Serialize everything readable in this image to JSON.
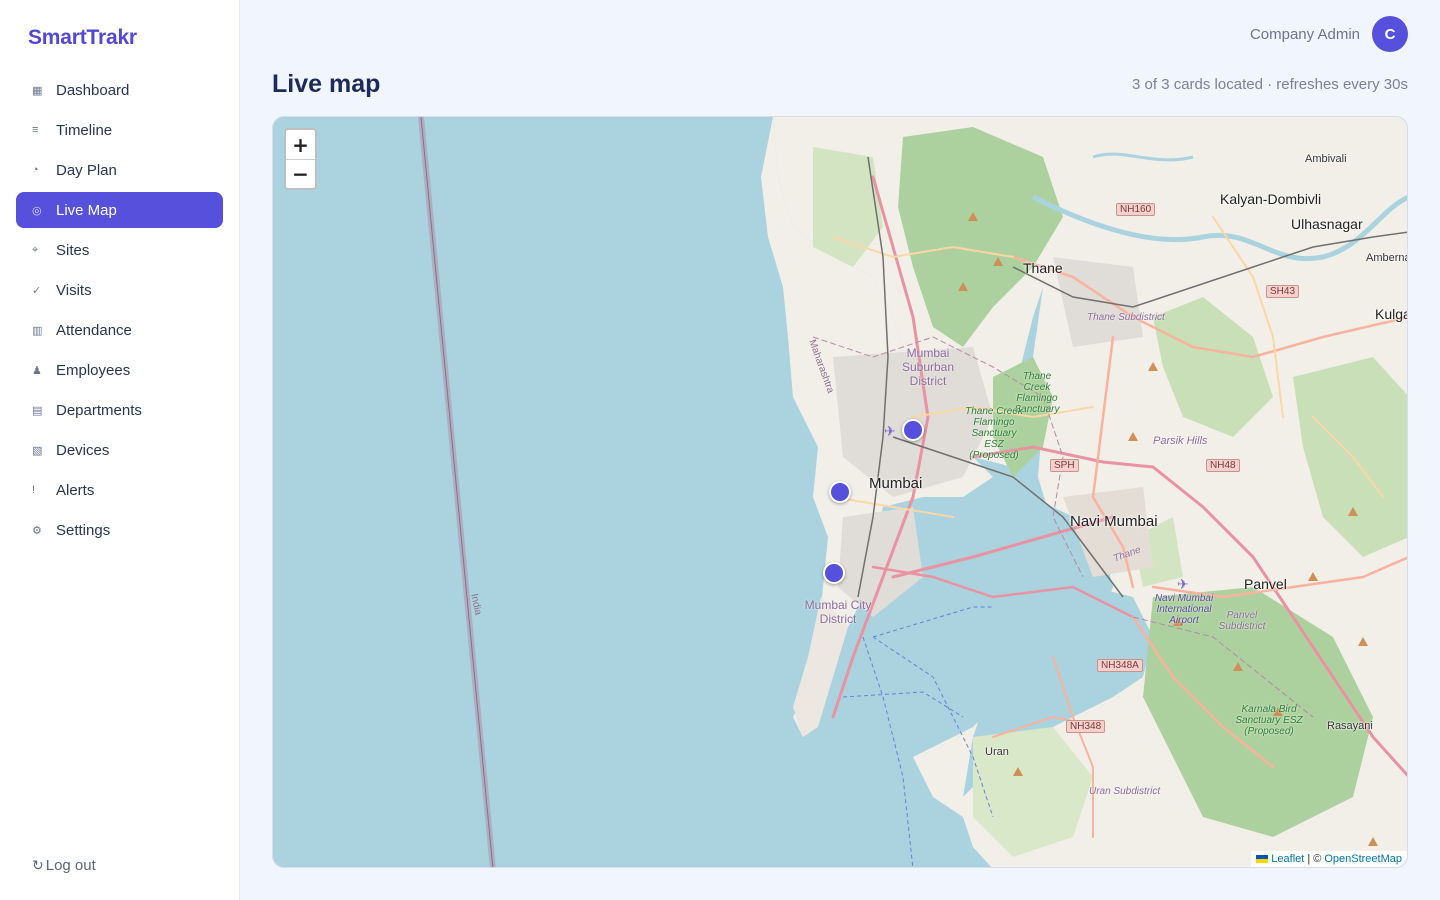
{
  "brand": "SmartTrakr",
  "nav": [
    {
      "label": "Dashboard",
      "icon": "▦",
      "icon_name": "dashboard-icon"
    },
    {
      "label": "Timeline",
      "icon": "≡",
      "icon_name": "timeline-icon"
    },
    {
      "label": "Day Plan",
      "icon": "◔",
      "icon_name": "day-plan-icon"
    },
    {
      "label": "Live Map",
      "icon": "◎",
      "icon_name": "live-map-icon",
      "active": true
    },
    {
      "label": "Sites",
      "icon": "⌖",
      "icon_name": "sites-icon"
    },
    {
      "label": "Visits",
      "icon": "✓",
      "icon_name": "visits-icon"
    },
    {
      "label": "Attendance",
      "icon": "▥",
      "icon_name": "attendance-icon"
    },
    {
      "label": "Employees",
      "icon": "♟",
      "icon_name": "employees-icon"
    },
    {
      "label": "Departments",
      "icon": "▤",
      "icon_name": "departments-icon"
    },
    {
      "label": "Devices",
      "icon": "▧",
      "icon_name": "devices-icon"
    },
    {
      "label": "Alerts",
      "icon": "!",
      "icon_name": "alerts-icon"
    },
    {
      "label": "Settings",
      "icon": "⚙",
      "icon_name": "settings-icon"
    }
  ],
  "logout": {
    "label": "Log out",
    "icon": "↻"
  },
  "user": {
    "name": "Company Admin",
    "initial": "C"
  },
  "page": {
    "title": "Live map",
    "status": "3 of 3 cards located · refreshes every 30s"
  },
  "map": {
    "zoom_in": "+",
    "zoom_out": "−",
    "markers": 3,
    "attribution": {
      "leaflet": "Leaflet",
      "separator": "| ©",
      "osm": "OpenStreetMap"
    },
    "labels": {
      "thane": "Thane",
      "kalyan": "Kalyan-Dombivli",
      "ulhasnagar": "Ulhasnagar",
      "ambivali": "Ambivali",
      "ambernath": "Ambernath",
      "kulgaon": "Kulga",
      "mumbai": "Mumbai",
      "navi_mumbai": "Navi Mumbai",
      "panvel": "Panvel",
      "uran": "Uran",
      "rasayani": "Rasayani",
      "parsik": "Parsik Hills",
      "mumbai_suburban": "Mumbai Suburban District",
      "mumbai_city": "Mumbai City District",
      "thane_subdistrict": "Thane Subdistrict",
      "panvel_subdistrict": "Panvel Subdistrict",
      "uran_subdistrict": "Uran Subdistrict",
      "flamingo": "Thane Creek Flamingo Sanctuary",
      "flamingo_esz": "Thane Creek Flamingo Sanctuary ESZ (Proposed)",
      "karnala": "Karnala Bird Sanctuary ESZ (Proposed)",
      "airport": "Navi Mumbai International Airport",
      "maharashtra": "Maharashtra",
      "india": "India",
      "thane_creek": "Thane",
      "nh160": "NH160",
      "sh43": "SH43",
      "sph": "SPH",
      "nh48": "NH48",
      "nh348a": "NH348A",
      "nh348": "NH348"
    }
  }
}
